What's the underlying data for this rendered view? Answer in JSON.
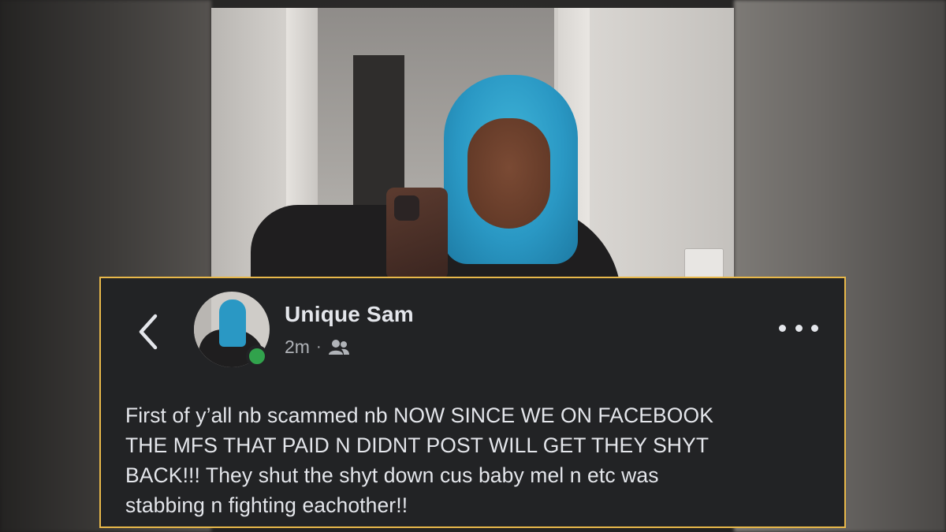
{
  "post": {
    "author": "Unique Sam",
    "timestamp": "2m",
    "separator": "·",
    "audience_icon": "friends-icon",
    "back_icon": "chevron-left-icon",
    "more_icon": "more-horizontal-icon",
    "online_status_color": "#31a24c",
    "body": "First of y’all nb scammed nb NOW SINCE WE ON FACEBOOK\nTHE MFS THAT PAID N DIDNT POST WILL GET THEY SHYT\nBACK!!! They shut the shyt down cus baby mel n etc was\nstabbing n fighting eachother!!"
  },
  "colors": {
    "card_background": "#222325",
    "card_border": "#e8b84a",
    "primary_text": "#e4e6eb",
    "secondary_text": "#b0b3b8",
    "hair_accent": "#2a98c4"
  }
}
